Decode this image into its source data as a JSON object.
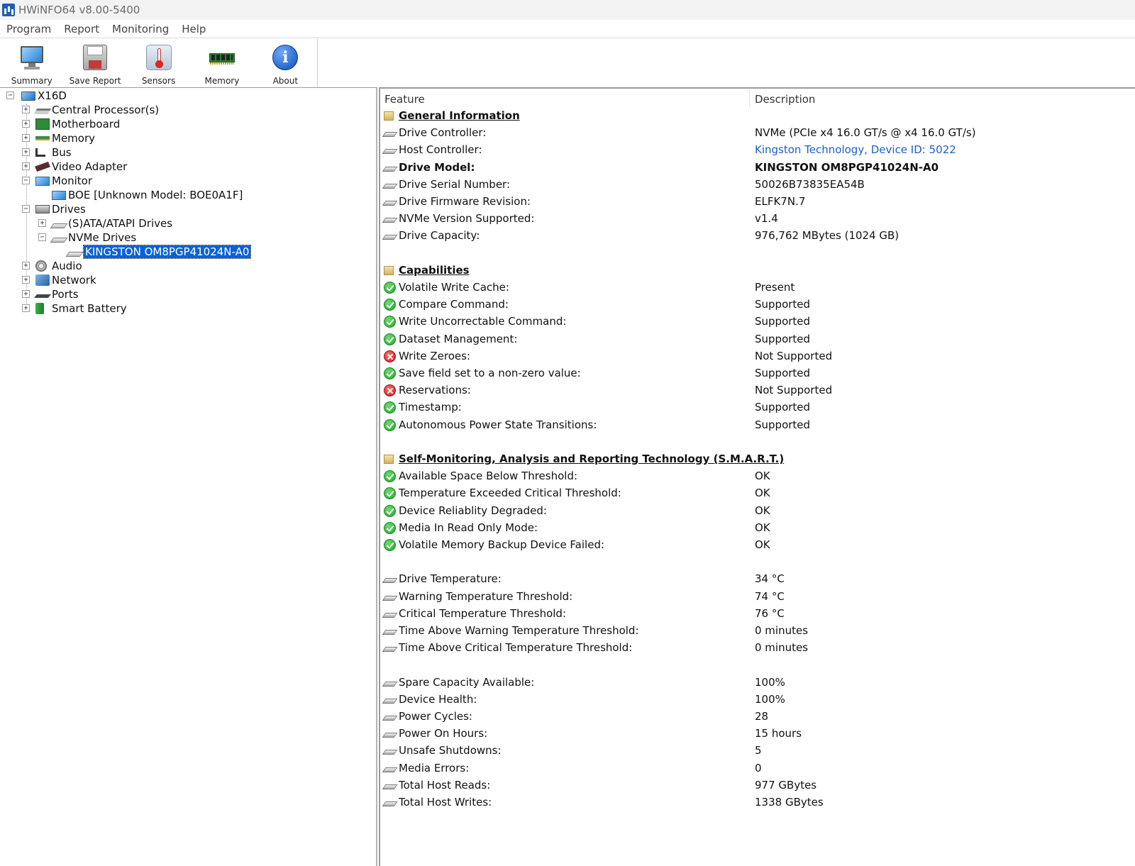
{
  "window": {
    "title": "HWiNFO64 v8.00-5400"
  },
  "menu": [
    "Program",
    "Report",
    "Monitoring",
    "Help"
  ],
  "toolbar": {
    "summary": "Summary",
    "save_report": "Save Report",
    "sensors": "Sensors",
    "memory": "Memory",
    "about": "About"
  },
  "tree": {
    "root": "X16D",
    "items": {
      "cpu": "Central Processor(s)",
      "motherboard": "Motherboard",
      "memory": "Memory",
      "bus": "Bus",
      "video": "Video Adapter",
      "monitor": "Monitor",
      "monitor_child": "BOE [Unknown Model: BOE0A1F]",
      "drives": "Drives",
      "sata": "(S)ATA/ATAPI Drives",
      "nvme": "NVMe Drives",
      "nvme_child": "KINGSTON OM8PGP41024N-A0",
      "audio": "Audio",
      "network": "Network",
      "ports": "Ports",
      "battery": "Smart Battery"
    }
  },
  "details": {
    "header": {
      "feature": "Feature",
      "description": "Description"
    },
    "rows": [
      {
        "feature": "General Information",
        "value": "",
        "icon": "section-icon",
        "type": "section"
      },
      {
        "feature": "Drive Controller:",
        "value": "NVMe (PCIe x4 16.0 GT/s @ x4 16.0 GT/s)",
        "icon": "drive-icon"
      },
      {
        "feature": "Host Controller:",
        "value": "Kingston Technology, Device ID: 5022",
        "icon": "drive-icon",
        "link": true
      },
      {
        "feature": "Drive Model:",
        "value": "KINGSTON OM8PGP41024N-A0",
        "icon": "drive-icon",
        "bold": true
      },
      {
        "feature": "Drive Serial Number:",
        "value": "50026B73835EA54B",
        "icon": "drive-icon"
      },
      {
        "feature": "Drive Firmware Revision:",
        "value": "ELFK7N.7",
        "icon": "drive-icon"
      },
      {
        "feature": "NVMe Version Supported:",
        "value": "v1.4",
        "icon": "drive-icon"
      },
      {
        "feature": "Drive Capacity:",
        "value": "976,762 MBytes (1024 GB)",
        "icon": "drive-icon"
      },
      {
        "feature": "Capabilities",
        "value": "",
        "icon": "section-icon",
        "type": "section"
      },
      {
        "feature": "Volatile Write Cache:",
        "value": "Present",
        "icon": "check-icon"
      },
      {
        "feature": "Compare Command:",
        "value": "Supported",
        "icon": "check-icon"
      },
      {
        "feature": "Write Uncorrectable Command:",
        "value": "Supported",
        "icon": "check-icon"
      },
      {
        "feature": "Dataset Management:",
        "value": "Supported",
        "icon": "check-icon"
      },
      {
        "feature": "Write Zeroes:",
        "value": "Not Supported",
        "icon": "cross-icon"
      },
      {
        "feature": "Save field set to a non-zero value:",
        "value": "Supported",
        "icon": "check-icon"
      },
      {
        "feature": "Reservations:",
        "value": "Not Supported",
        "icon": "cross-icon"
      },
      {
        "feature": "Timestamp:",
        "value": "Supported",
        "icon": "check-icon"
      },
      {
        "feature": "Autonomous Power State Transitions:",
        "value": "Supported",
        "icon": "check-icon"
      },
      {
        "feature": "Self-Monitoring, Analysis and Reporting Technology (S.M.A.R.T.)",
        "value": "",
        "icon": "section-icon",
        "type": "section"
      },
      {
        "feature": "Available Space Below Threshold:",
        "value": "OK",
        "icon": "check-icon"
      },
      {
        "feature": "Temperature Exceeded Critical Threshold:",
        "value": "OK",
        "icon": "check-icon"
      },
      {
        "feature": "Device Reliablity Degraded:",
        "value": "OK",
        "icon": "check-icon"
      },
      {
        "feature": "Media In Read Only Mode:",
        "value": "OK",
        "icon": "check-icon"
      },
      {
        "feature": "Volatile Memory Backup Device Failed:",
        "value": "OK",
        "icon": "check-icon"
      },
      {
        "feature": "Drive Temperature:",
        "value": "34 °C",
        "icon": "drive-icon"
      },
      {
        "feature": "Warning Temperature Threshold:",
        "value": "74 °C",
        "icon": "drive-icon"
      },
      {
        "feature": "Critical Temperature Threshold:",
        "value": "76 °C",
        "icon": "drive-icon"
      },
      {
        "feature": "Time Above Warning Temperature Threshold:",
        "value": "0 minutes",
        "icon": "drive-icon"
      },
      {
        "feature": "Time Above Critical Temperature Threshold:",
        "value": "0 minutes",
        "icon": "drive-icon"
      },
      {
        "feature": "Spare Capacity Available:",
        "value": "100%",
        "icon": "drive-icon"
      },
      {
        "feature": "Device Health:",
        "value": "100%",
        "icon": "drive-icon"
      },
      {
        "feature": "Power Cycles:",
        "value": "28",
        "icon": "drive-icon"
      },
      {
        "feature": "Power On Hours:",
        "value": "15 hours",
        "icon": "drive-icon"
      },
      {
        "feature": "Unsafe Shutdowns:",
        "value": "5",
        "icon": "drive-icon"
      },
      {
        "feature": "Media Errors:",
        "value": "0",
        "icon": "drive-icon"
      },
      {
        "feature": "Total Host Reads:",
        "value": "977 GBytes",
        "icon": "drive-icon"
      },
      {
        "feature": "Total Host Writes:",
        "value": "1338 GBytes",
        "icon": "drive-icon"
      }
    ]
  },
  "colors": {
    "selection": "#0a62d6",
    "link": "#1a5fc9",
    "ok": "#21a62a",
    "error": "#c91f1f"
  }
}
